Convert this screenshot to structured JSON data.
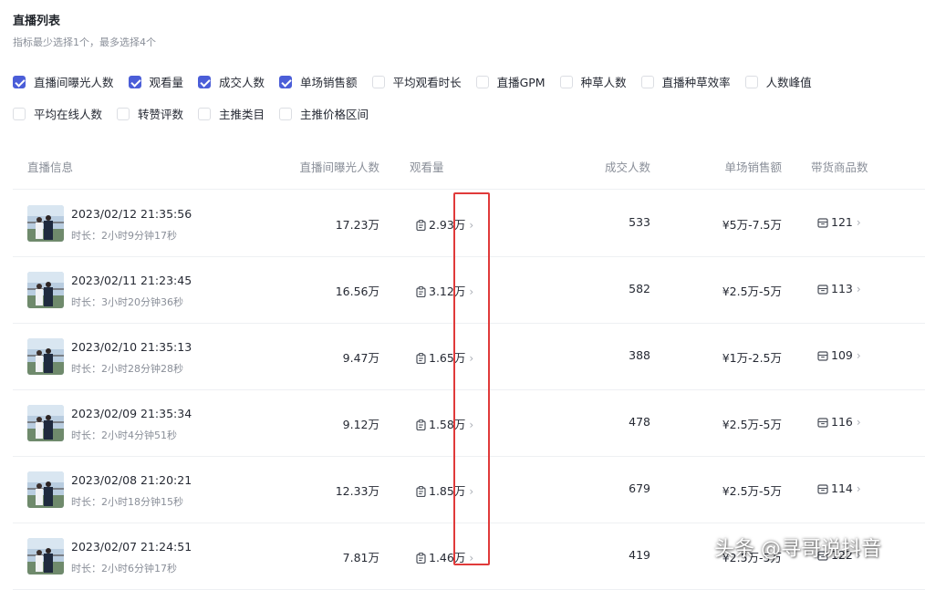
{
  "header": {
    "title": "直播列表",
    "subtitle": "指标最少选择1个，最多选择4个"
  },
  "metrics": {
    "row1": [
      {
        "label": "直播间曝光人数",
        "checked": true
      },
      {
        "label": "观看量",
        "checked": true
      },
      {
        "label": "成交人数",
        "checked": true
      },
      {
        "label": "单场销售额",
        "checked": true
      },
      {
        "label": "平均观看时长",
        "checked": false
      },
      {
        "label": "直播GPM",
        "checked": false
      },
      {
        "label": "种草人数",
        "checked": false
      },
      {
        "label": "直播种草效率",
        "checked": false
      },
      {
        "label": "人数峰值",
        "checked": false
      }
    ],
    "row2": [
      {
        "label": "平均在线人数",
        "checked": false
      },
      {
        "label": "转赞评数",
        "checked": false
      },
      {
        "label": "主推类目",
        "checked": false
      },
      {
        "label": "主推价格区间",
        "checked": false
      }
    ]
  },
  "table": {
    "headers": {
      "info": "直播信息",
      "exposure": "直播间曝光人数",
      "views": "观看量",
      "buyers": "成交人数",
      "sales": "单场销售额",
      "products": "带货商品数"
    },
    "duration_label": "时长：",
    "rows": [
      {
        "date": "2023/02/12 21:35:56",
        "duration": "2小时9分钟17秒",
        "exposure": "17.23万",
        "views": "2.93万",
        "buyers": "533",
        "sales": "¥5万-7.5万",
        "products": "121"
      },
      {
        "date": "2023/02/11 21:23:45",
        "duration": "3小时20分钟36秒",
        "exposure": "16.56万",
        "views": "3.12万",
        "buyers": "582",
        "sales": "¥2.5万-5万",
        "products": "113"
      },
      {
        "date": "2023/02/10 21:35:13",
        "duration": "2小时28分钟28秒",
        "exposure": "9.47万",
        "views": "1.65万",
        "buyers": "388",
        "sales": "¥1万-2.5万",
        "products": "109"
      },
      {
        "date": "2023/02/09 21:35:34",
        "duration": "2小时4分钟51秒",
        "exposure": "9.12万",
        "views": "1.58万",
        "buyers": "478",
        "sales": "¥2.5万-5万",
        "products": "116"
      },
      {
        "date": "2023/02/08 21:20:21",
        "duration": "2小时18分钟15秒",
        "exposure": "12.33万",
        "views": "1.85万",
        "buyers": "679",
        "sales": "¥2.5万-5万",
        "products": "114"
      },
      {
        "date": "2023/02/07 21:24:51",
        "duration": "2小时6分钟17秒",
        "exposure": "7.81万",
        "views": "1.46万",
        "buyers": "419",
        "sales": "¥2.5万-5万",
        "products": "122"
      }
    ]
  },
  "annotation": {
    "color": "#e03a3a"
  },
  "watermark": {
    "text": "头条 @寻哥说抖音"
  },
  "colors": {
    "accent": "#4b5ed8",
    "muted": "#8a8f99",
    "text": "#252933"
  }
}
